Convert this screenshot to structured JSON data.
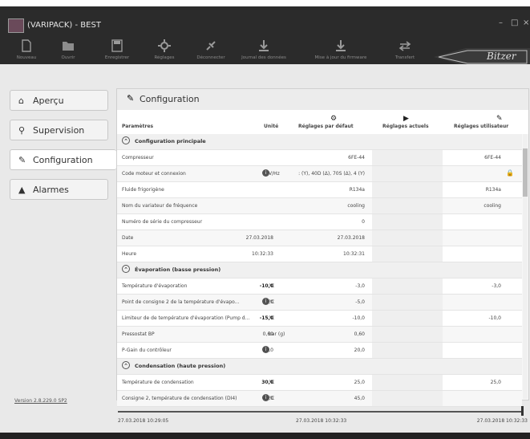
{
  "window": {
    "title": "(VARIPACK) - BEST",
    "controls": [
      "–",
      "□",
      "×"
    ]
  },
  "toolbar": {
    "items": [
      {
        "label": "Nouveau",
        "icon": "new-file-icon"
      },
      {
        "label": "Ouvrir",
        "icon": "open-folder-icon"
      },
      {
        "label": "Enregistrer",
        "icon": "save-icon"
      },
      {
        "label": "Réglages",
        "icon": "settings-gear-icon"
      },
      {
        "label": "Déconnecter",
        "icon": "disconnect-plug-icon"
      },
      {
        "label": "Journal des données",
        "icon": "download-log-icon"
      },
      {
        "label": "Mise à jour du firmware",
        "icon": "firmware-update-icon"
      },
      {
        "label": "Transfert",
        "icon": "transfer-arrows-icon"
      }
    ],
    "logo_text": "Bitzer"
  },
  "sidebar": {
    "items": [
      {
        "label": "Aperçu",
        "icon": "home-icon"
      },
      {
        "label": "Supervision",
        "icon": "search-icon"
      },
      {
        "label": "Configuration",
        "icon": "wrench-icon"
      },
      {
        "label": "Alarmes",
        "icon": "warning-icon"
      }
    ],
    "active": "Configuration",
    "version": "Version 2.8.229.0 SP2"
  },
  "panel": {
    "title": "Configuration",
    "columns": {
      "param": "Paramètres",
      "unit": "Unité",
      "default": "Réglages par défaut",
      "actual": "Réglages actuels",
      "user": "Réglages utilisateur"
    },
    "sections": [
      {
        "title": "Configuration principale",
        "rows": [
          {
            "param": "Compresseur",
            "unit": "",
            "default": "",
            "actual": "6FE-44",
            "user": "6FE-44"
          },
          {
            "param": "Code moteur et connexion",
            "unit": "V/Hz",
            "info": true,
            "default": "",
            "actual": ": (Y), 40D (Δ), 70S (Δ), 4 (Y)",
            "user": "",
            "lock": true
          },
          {
            "param": "Fluide frigorigène",
            "unit": "",
            "default": "",
            "actual": "R134a",
            "user": "R134a"
          },
          {
            "param": "Nom du variateur de fréquence",
            "unit": "",
            "default": "",
            "actual": "cooling",
            "user": "cooling"
          },
          {
            "param": "Numéro de série du compresseur",
            "unit": "",
            "default": "",
            "actual": "0",
            "user": ""
          },
          {
            "param": "Date",
            "unit": "",
            "default": "27.03.2018",
            "actual": "27.03.2018",
            "user": ""
          },
          {
            "param": "Heure",
            "unit": "",
            "default": "10:32:33",
            "actual": "10:32:31",
            "user": ""
          }
        ]
      },
      {
        "title": "Évaporation (basse pression)",
        "rows": [
          {
            "param": "Température d'évaporation",
            "unit": "°C",
            "default": "-10,0",
            "default_bold": true,
            "actual": "-3,0",
            "user": "-3,0"
          },
          {
            "param": "Point de consigne 2 de la température d'évapo...",
            "unit": "°C",
            "info": true,
            "default": "-5,0",
            "actual": "-5,0",
            "user": ""
          },
          {
            "param": "Limiteur de de température d'évaporation (Pump d...",
            "unit": "°C",
            "default": "-15,0",
            "default_bold": true,
            "actual": "-10,0",
            "user": "-10,0"
          },
          {
            "param": "Pressostat BP",
            "unit": "bar (g)",
            "default": "0,60",
            "actual": "0,60",
            "user": ""
          },
          {
            "param": "P-Gain du contrôleur",
            "unit": "",
            "info": true,
            "default": "20,0",
            "actual": "20,0",
            "user": ""
          }
        ]
      },
      {
        "title": "Condensation (haute pression)",
        "rows": [
          {
            "param": "Température de condensation",
            "unit": "°C",
            "default": "30,0",
            "default_bold": true,
            "actual": "25,0",
            "user": "25,0"
          },
          {
            "param": "Consigne 2, température de condensation (DI4)",
            "unit": "°C",
            "info": true,
            "default": "45,0",
            "actual": "45,0",
            "user": ""
          }
        ]
      }
    ]
  },
  "timeline": {
    "start": "27.03.2018 10:29:05",
    "middle": "27.03.2018 10:32:33",
    "end": "27.03.2018 10:32:33"
  }
}
